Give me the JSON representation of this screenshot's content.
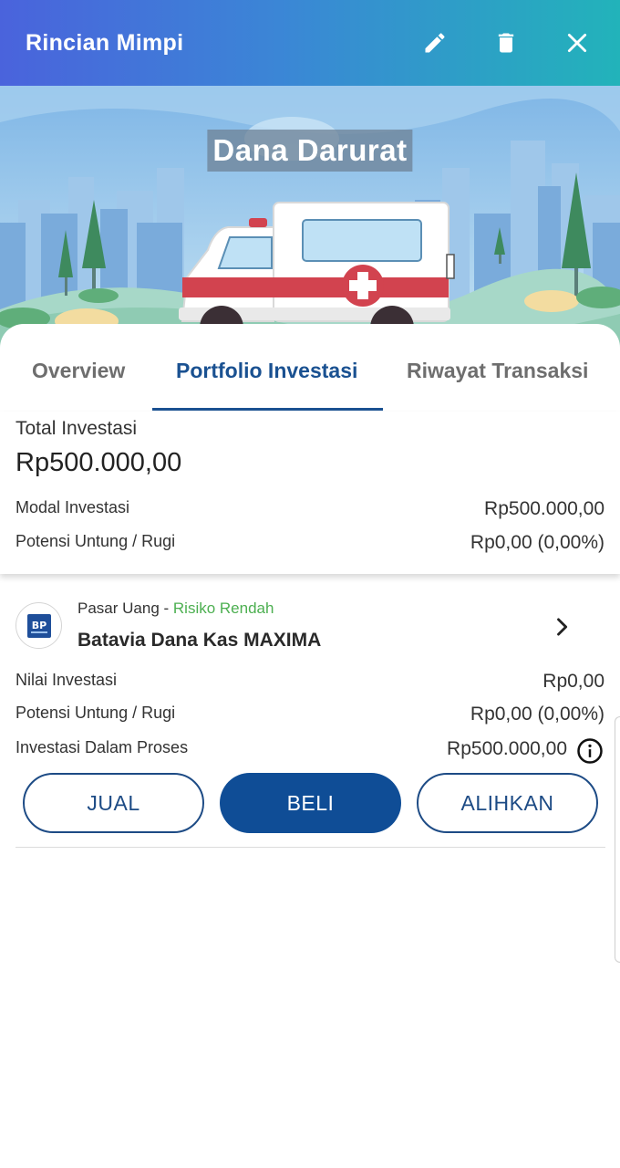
{
  "app_bar": {
    "title": "Rincian Mimpi",
    "icons": [
      "pencil-icon",
      "trash-icon",
      "close-icon"
    ],
    "gradient": [
      "#4a63dc",
      "#22b3ba"
    ]
  },
  "hero": {
    "title": "Dana Darurat",
    "illustration": "ambulance-city-illustration"
  },
  "tabs": [
    {
      "label": "Overview",
      "active": false
    },
    {
      "label": "Portfolio Investasi",
      "active": true
    },
    {
      "label": "Riwayat Transaksi",
      "active": false
    }
  ],
  "summary": {
    "total_label": "Total Investasi",
    "total_value": "Rp500.000,00",
    "rows": [
      {
        "label": "Modal Investasi",
        "value": "Rp500.000,00"
      },
      {
        "label": "Potensi Untung / Rugi",
        "value": "Rp0,00 (0,00%)"
      }
    ]
  },
  "product": {
    "category": "Pasar Uang",
    "separator": " - ",
    "risk": "Risiko Rendah",
    "risk_color": "#4caf50",
    "name": "Batavia Dana Kas MAXIMA",
    "logo_text": "BP",
    "rows": [
      {
        "label": "Nilai Investasi",
        "value": "Rp0,00"
      },
      {
        "label": "Potensi Untung / Rugi",
        "value": "Rp0,00 (0,00%)"
      },
      {
        "label": "Investasi Dalam Proses",
        "value": "Rp500.000,00"
      }
    ]
  },
  "actions": {
    "sell": "JUAL",
    "buy": "BELI",
    "switch": "ALIHKAN"
  },
  "colors": {
    "primary": "#0f4d96",
    "tab_active": "#1a5191"
  }
}
